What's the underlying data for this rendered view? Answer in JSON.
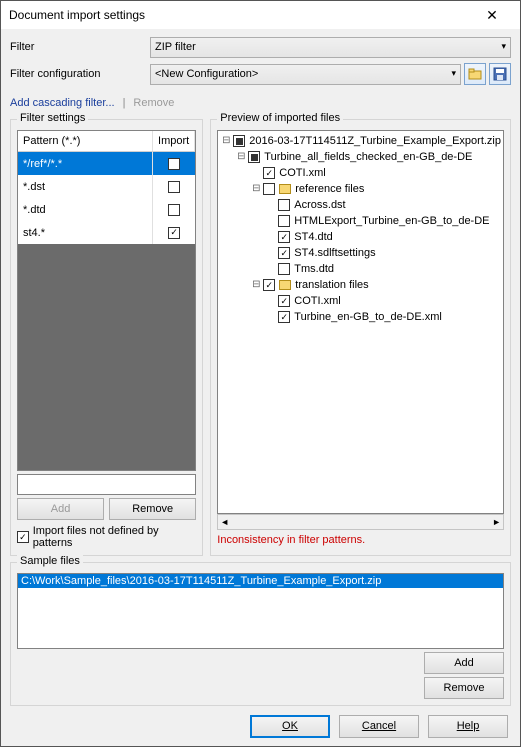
{
  "window": {
    "title": "Document import settings"
  },
  "filter": {
    "label": "Filter",
    "value": "ZIP filter",
    "config_label": "Filter configuration",
    "config_value": "<New Configuration>"
  },
  "links": {
    "cascading": "Add cascading filter...",
    "remove": "Remove"
  },
  "filter_settings": {
    "title": "Filter settings",
    "cols": {
      "pattern": "Pattern (*.*)",
      "import": "Import"
    },
    "rows": [
      {
        "pattern": "*/ref*/*.*",
        "import": false,
        "selected": true
      },
      {
        "pattern": "*.dst",
        "import": false,
        "selected": false
      },
      {
        "pattern": "*.dtd",
        "import": false,
        "selected": false
      },
      {
        "pattern": "st4.*",
        "import": true,
        "selected": false
      }
    ],
    "add_btn": "Add",
    "remove_btn": "Remove",
    "import_undefined": "Import files not defined by patterns",
    "import_undefined_checked": true
  },
  "preview": {
    "title": "Preview of imported files",
    "warning": "Inconsistency in filter patterns.",
    "tree": {
      "root": "2016-03-17T114511Z_Turbine_Example_Export.zip",
      "folder": "Turbine_all_fields_checked_en-GB_de-DE",
      "coti1": "COTI.xml",
      "ref_folder": "reference files",
      "refs": [
        "Across.dst",
        "HTMLExport_Turbine_en-GB_to_de-DE",
        "ST4.dtd",
        "ST4.sdlftsettings",
        "Tms.dtd"
      ],
      "trans_folder": "translation files",
      "trans": [
        "COTI.xml",
        "Turbine_en-GB_to_de-DE.xml"
      ]
    }
  },
  "sample": {
    "title": "Sample files",
    "items": [
      "C:\\Work\\Sample_files\\2016-03-17T114511Z_Turbine_Example_Export.zip"
    ],
    "add_btn": "Add",
    "remove_btn": "Remove"
  },
  "footer": {
    "ok": "OK",
    "cancel": "Cancel",
    "help": "Help"
  }
}
